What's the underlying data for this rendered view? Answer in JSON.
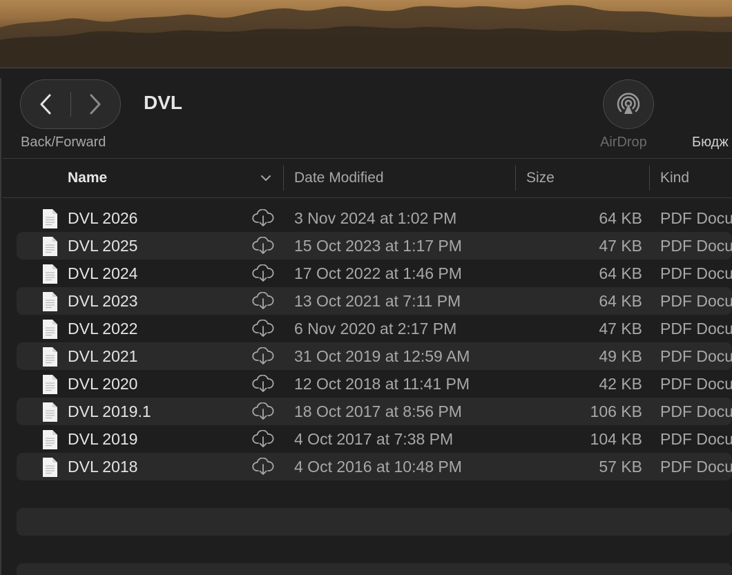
{
  "toolbar": {
    "nav_label": "Back/Forward",
    "title": "DVL",
    "airdrop_label": "AirDrop",
    "budget_label": "Бюдж"
  },
  "columns": {
    "name": "Name",
    "date": "Date Modified",
    "size": "Size",
    "kind": "Kind"
  },
  "files": [
    {
      "name": "DVL 2026",
      "date": "3 Nov 2024 at 1:02 PM",
      "size": "64 KB",
      "kind": "PDF Docu"
    },
    {
      "name": "DVL 2025",
      "date": "15 Oct 2023 at 1:17 PM",
      "size": "47 KB",
      "kind": "PDF Docu"
    },
    {
      "name": "DVL 2024",
      "date": "17 Oct 2022 at 1:46 PM",
      "size": "64 KB",
      "kind": "PDF Docu"
    },
    {
      "name": "DVL 2023",
      "date": "13 Oct 2021 at 7:11 PM",
      "size": "64 KB",
      "kind": "PDF Docu"
    },
    {
      "name": "DVL 2022",
      "date": "6 Nov 2020 at 2:17 PM",
      "size": "47 KB",
      "kind": "PDF Docu"
    },
    {
      "name": "DVL 2021",
      "date": "31 Oct 2019 at 12:59 AM",
      "size": "49 KB",
      "kind": "PDF Docu"
    },
    {
      "name": "DVL 2020",
      "date": "12 Oct 2018 at 11:41 PM",
      "size": "42 KB",
      "kind": "PDF Docu"
    },
    {
      "name": "DVL 2019.1",
      "date": "18 Oct 2017 at 8:56 PM",
      "size": "106 KB",
      "kind": "PDF Docu"
    },
    {
      "name": "DVL 2019",
      "date": "4 Oct 2017 at 7:38 PM",
      "size": "104 KB",
      "kind": "PDF Docu"
    },
    {
      "name": "DVL 2018",
      "date": "4 Oct 2016 at 10:48 PM",
      "size": "57 KB",
      "kind": "PDF Docu"
    }
  ],
  "icons": {
    "file": "pdf-document-icon",
    "cloud": "cloud-download-icon",
    "airdrop": "airdrop-icon",
    "back": "chevron-left-icon",
    "forward": "chevron-right-icon",
    "sort": "chevron-down-icon"
  },
  "colors": {
    "window_bg": "#1e1e1e",
    "row_alt": "#2a2a2a",
    "primary_text": "#e4e4e4",
    "secondary_text": "#a8a8a8"
  }
}
